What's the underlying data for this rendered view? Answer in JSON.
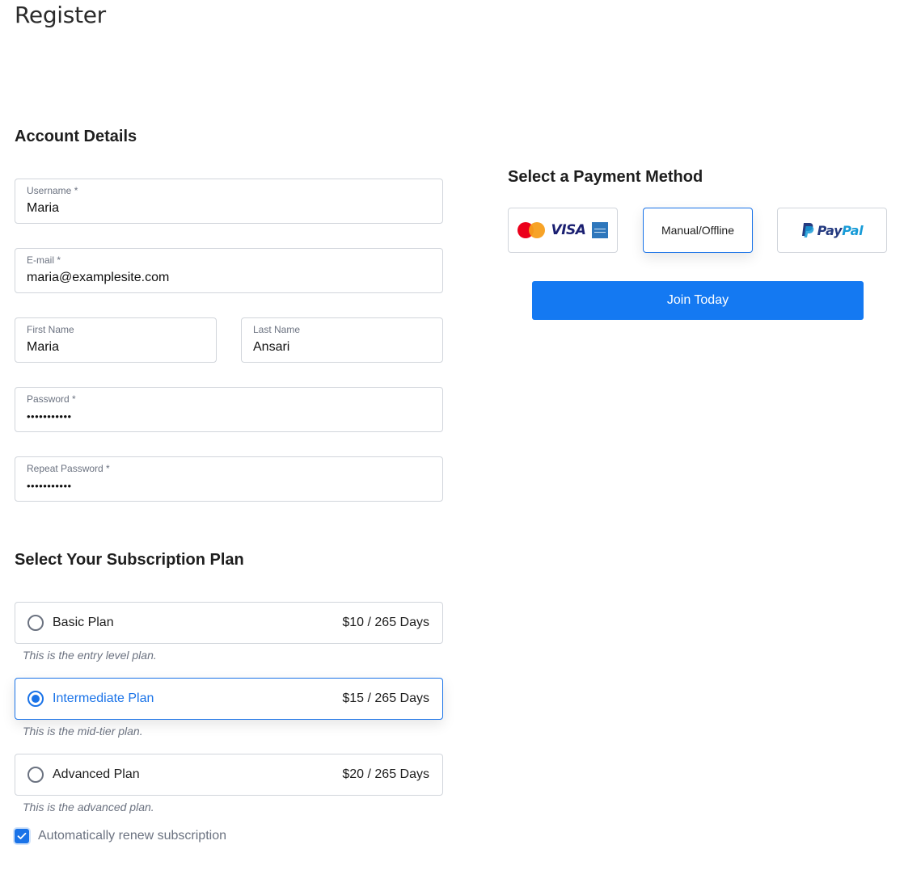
{
  "page": {
    "title": "Register"
  },
  "account": {
    "title": "Account Details",
    "fields": {
      "username": {
        "label": "Username *",
        "value": "Maria"
      },
      "email": {
        "label": "E-mail *",
        "value": "maria@examplesite.com"
      },
      "first_name": {
        "label": "First Name",
        "value": "Maria"
      },
      "last_name": {
        "label": "Last Name",
        "value": "Ansari"
      },
      "password": {
        "label": "Password *",
        "value": "•••••••••••"
      },
      "repeat_password": {
        "label": "Repeat Password *",
        "value": "•••••••••••"
      }
    }
  },
  "subscription": {
    "title": "Select Your Subscription Plan",
    "plans": [
      {
        "name": "Basic Plan",
        "price": "$10 / 265 Days",
        "description": "This is the entry level plan.",
        "selected": false
      },
      {
        "name": "Intermediate Plan",
        "price": "$15 / 265 Days",
        "description": "This is the mid-tier plan.",
        "selected": true
      },
      {
        "name": "Advanced Plan",
        "price": "$20 / 265 Days",
        "description": "This is the advanced plan.",
        "selected": false
      }
    ],
    "auto_renew": {
      "label": "Automatically renew subscription",
      "checked": true
    }
  },
  "payment": {
    "title": "Select a Payment Method",
    "methods": [
      {
        "id": "cards",
        "label": "Mastercard / VISA / American Express",
        "icons": [
          "mastercard-icon",
          "visa-icon",
          "amex-icon"
        ],
        "selected": false
      },
      {
        "id": "manual",
        "label": "Manual/Offline",
        "selected": true
      },
      {
        "id": "paypal",
        "label": "PayPal",
        "word_part1": "Pay",
        "word_part2": "Pal",
        "icons": [
          "paypal-icon"
        ],
        "selected": false
      }
    ],
    "submit_label": "Join Today"
  },
  "colors": {
    "accent": "#1a73e8",
    "button": "#1479f2",
    "border": "#d1d5db",
    "muted_text": "#6b7280"
  }
}
